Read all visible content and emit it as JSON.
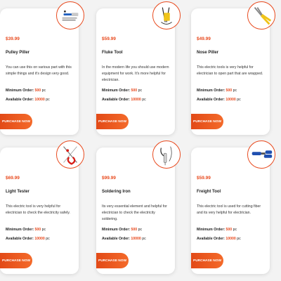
{
  "products": [
    {
      "price": "$39.99",
      "name": "Pulley Piller",
      "description": "You can use this on various part with this simple things and it's design very good.",
      "min_label": "Minimum Order:",
      "min_value": "500",
      "min_unit": "pc",
      "avail_label": "Available Order:",
      "avail_value": "10000",
      "avail_unit": "pc",
      "button": "PURCHASE NOW",
      "icon": "pulley-tool-icon"
    },
    {
      "price": "$59.99",
      "name": "Fluke Tool",
      "description": "In the modern life you should use modern equipment for work. It's more helpful for electrician.",
      "min_label": "Minimum Order:",
      "min_value": "500",
      "min_unit": "pc",
      "avail_label": "Available Order:",
      "avail_value": "10000",
      "avail_unit": "pc",
      "button": "PURCHASE NOW",
      "icon": "multimeter-probes-icon"
    },
    {
      "price": "$49.99",
      "name": "Nose Piller",
      "description": "This electric tools is very helpful for electrician to open part that are wrapped.",
      "min_label": "Minimum Order:",
      "min_value": "500",
      "min_unit": "pc",
      "avail_label": "Available Order:",
      "avail_value": "10000",
      "avail_unit": "pc",
      "button": "PURCHASE NOW",
      "icon": "nose-plier-icon"
    },
    {
      "price": "$69.99",
      "name": "Light Tester",
      "description": "This electric tool is very helpful for electrician to check the electricity safely.",
      "min_label": "Minimum Order:",
      "min_value": "500",
      "min_unit": "pc",
      "avail_label": "Available Order:",
      "avail_value": "10000",
      "avail_unit": "pc",
      "button": "PURCHASE NOW",
      "icon": "light-tester-icon"
    },
    {
      "price": "$99.99",
      "name": "Soldering Iron",
      "description": "Its very essential element and helpful for electrician to check the electricity soldering.",
      "min_label": "Minimum Order:",
      "min_value": "500",
      "min_unit": "pc",
      "avail_label": "Available Order:",
      "avail_value": "10000",
      "avail_unit": "pc",
      "button": "PURCHASE NOW",
      "icon": "soldering-iron-icon"
    },
    {
      "price": "$59.99",
      "name": "Freight Tool",
      "description": "This electric tool is used for cutting fiber and its very helpful for electrician.",
      "min_label": "Minimum Order:",
      "min_value": "500",
      "min_unit": "pc",
      "avail_label": "Available Order:",
      "avail_value": "10000",
      "avail_unit": "pc",
      "button": "PURCHASE NOW",
      "icon": "crimping-tool-icon"
    }
  ],
  "colors": {
    "accent": "#e8491d",
    "card": "#ffffff",
    "background": "#f3f3f3"
  }
}
